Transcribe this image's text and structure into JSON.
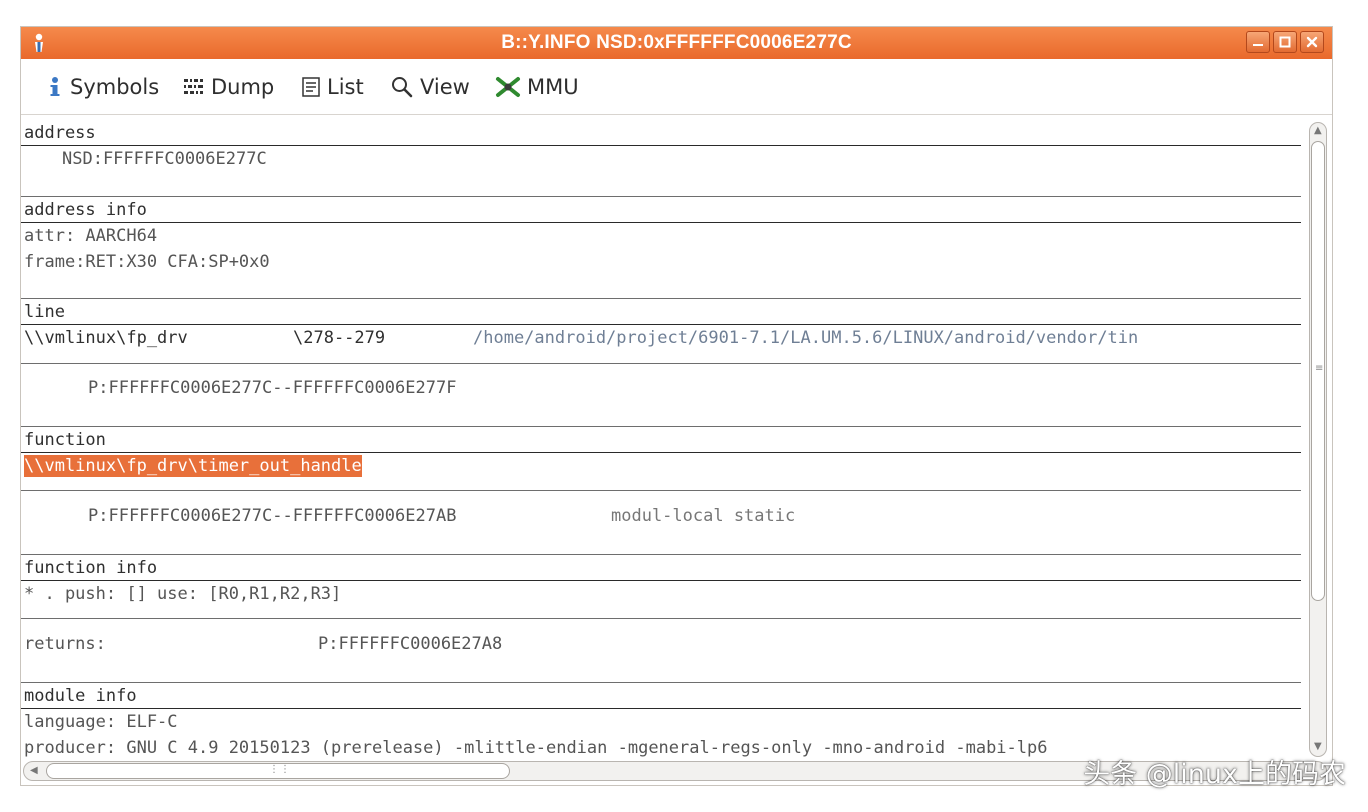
{
  "window": {
    "title": "B::Y.INFO NSD:0xFFFFFFC0006E277C"
  },
  "toolbar": {
    "symbols": "Symbols",
    "dump": "Dump",
    "list": "List",
    "view": "View",
    "mmu": "MMU"
  },
  "sections": {
    "address": {
      "header": "address",
      "value": "NSD:FFFFFFC0006E277C"
    },
    "address_info": {
      "header": "address info",
      "attr": "attr: AARCH64",
      "frame": "frame:RET:X30 CFA:SP+0x0"
    },
    "line": {
      "header": "line",
      "symbol": "\\\\vmlinux\\fp_drv",
      "lines": "\\278--279",
      "path": "/home/android/project/6901-7.1/LA.UM.5.6/LINUX/android/vendor/tin",
      "range": "P:FFFFFFC0006E277C--FFFFFFC0006E277F"
    },
    "function": {
      "header": "function",
      "name": "\\\\vmlinux\\fp_drv\\timer_out_handle",
      "range": "P:FFFFFFC0006E277C--FFFFFFC0006E27AB",
      "scope": "modul-local static"
    },
    "function_info": {
      "header": "function info",
      "push": "* . push: [] use: [R0,R1,R2,R3]",
      "returns_label": "returns:",
      "returns_value": "P:FFFFFFC0006E27A8"
    },
    "module_info": {
      "header": "module info",
      "language": "language: ELF-C",
      "producer": "producer: GNU C 4.9 20150123 (prerelease) -mlittle-endian -mgeneral-regs-only -mno-android -mabi-lp6"
    }
  },
  "watermark": "头条 @linux上的码农",
  "colors": {
    "titlebar": "#e9692c",
    "highlight": "#e8703a"
  }
}
